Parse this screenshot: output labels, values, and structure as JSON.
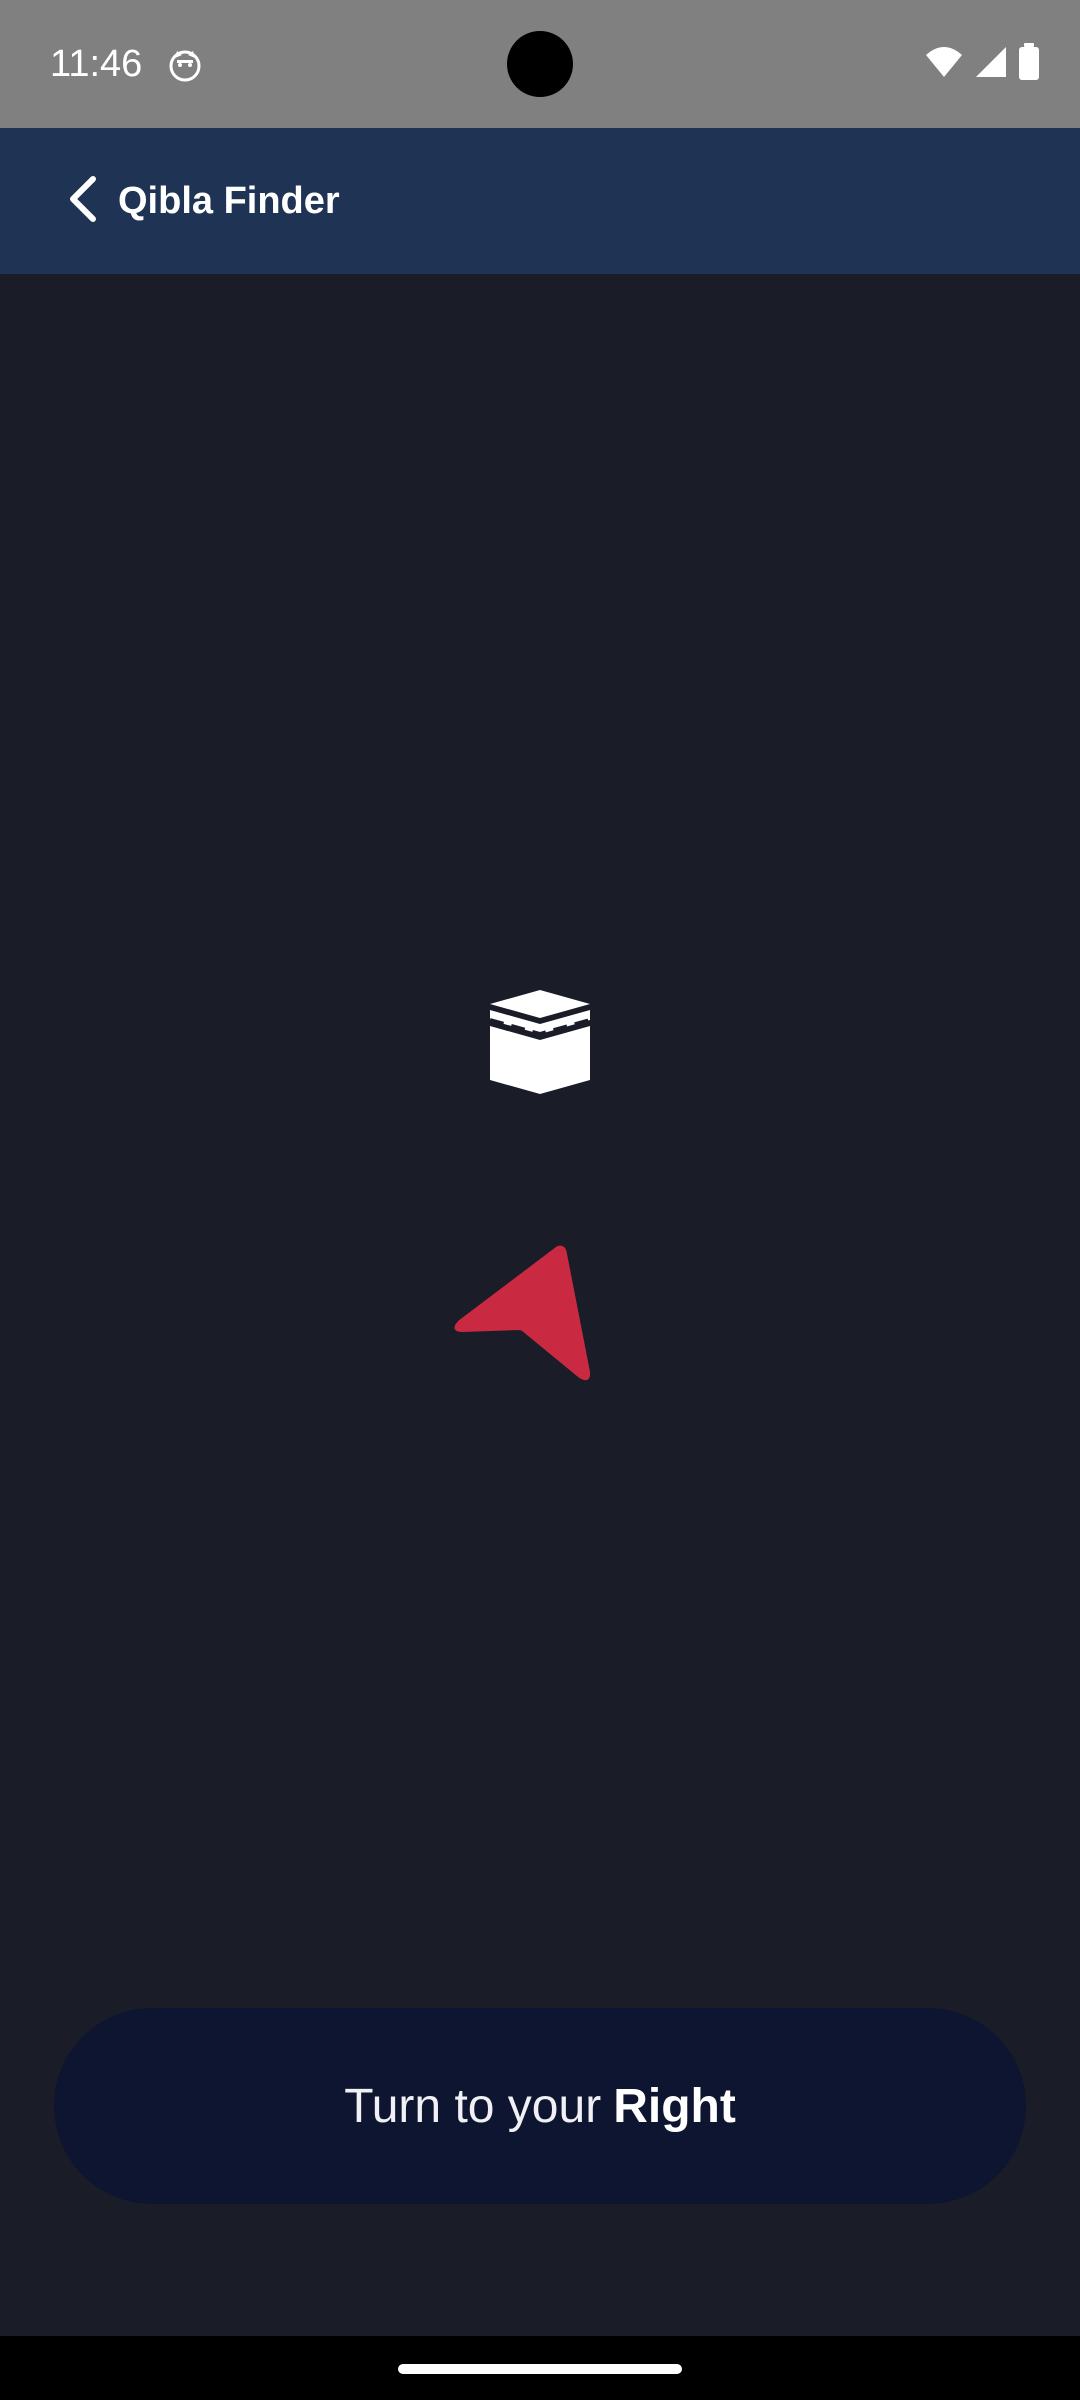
{
  "status_bar": {
    "time": "11:46",
    "notification_icon": "cat-face-icon",
    "wifi_icon": "wifi-icon",
    "signal_icon": "cellular-signal-icon",
    "battery_icon": "battery-icon"
  },
  "app_bar": {
    "title": "Qibla Finder",
    "back_icon": "chevron-left-icon",
    "background_color": "#1f3354"
  },
  "compass": {
    "kaaba_icon": "kaaba-icon",
    "arrow_icon": "navigation-arrow-icon",
    "arrow_color": "#c92a42"
  },
  "instruction": {
    "prefix": "Turn to your",
    "direction": "Right"
  },
  "colors": {
    "background": "#1a1c28",
    "pill": "#0e1530",
    "status_bar": "#808080"
  }
}
